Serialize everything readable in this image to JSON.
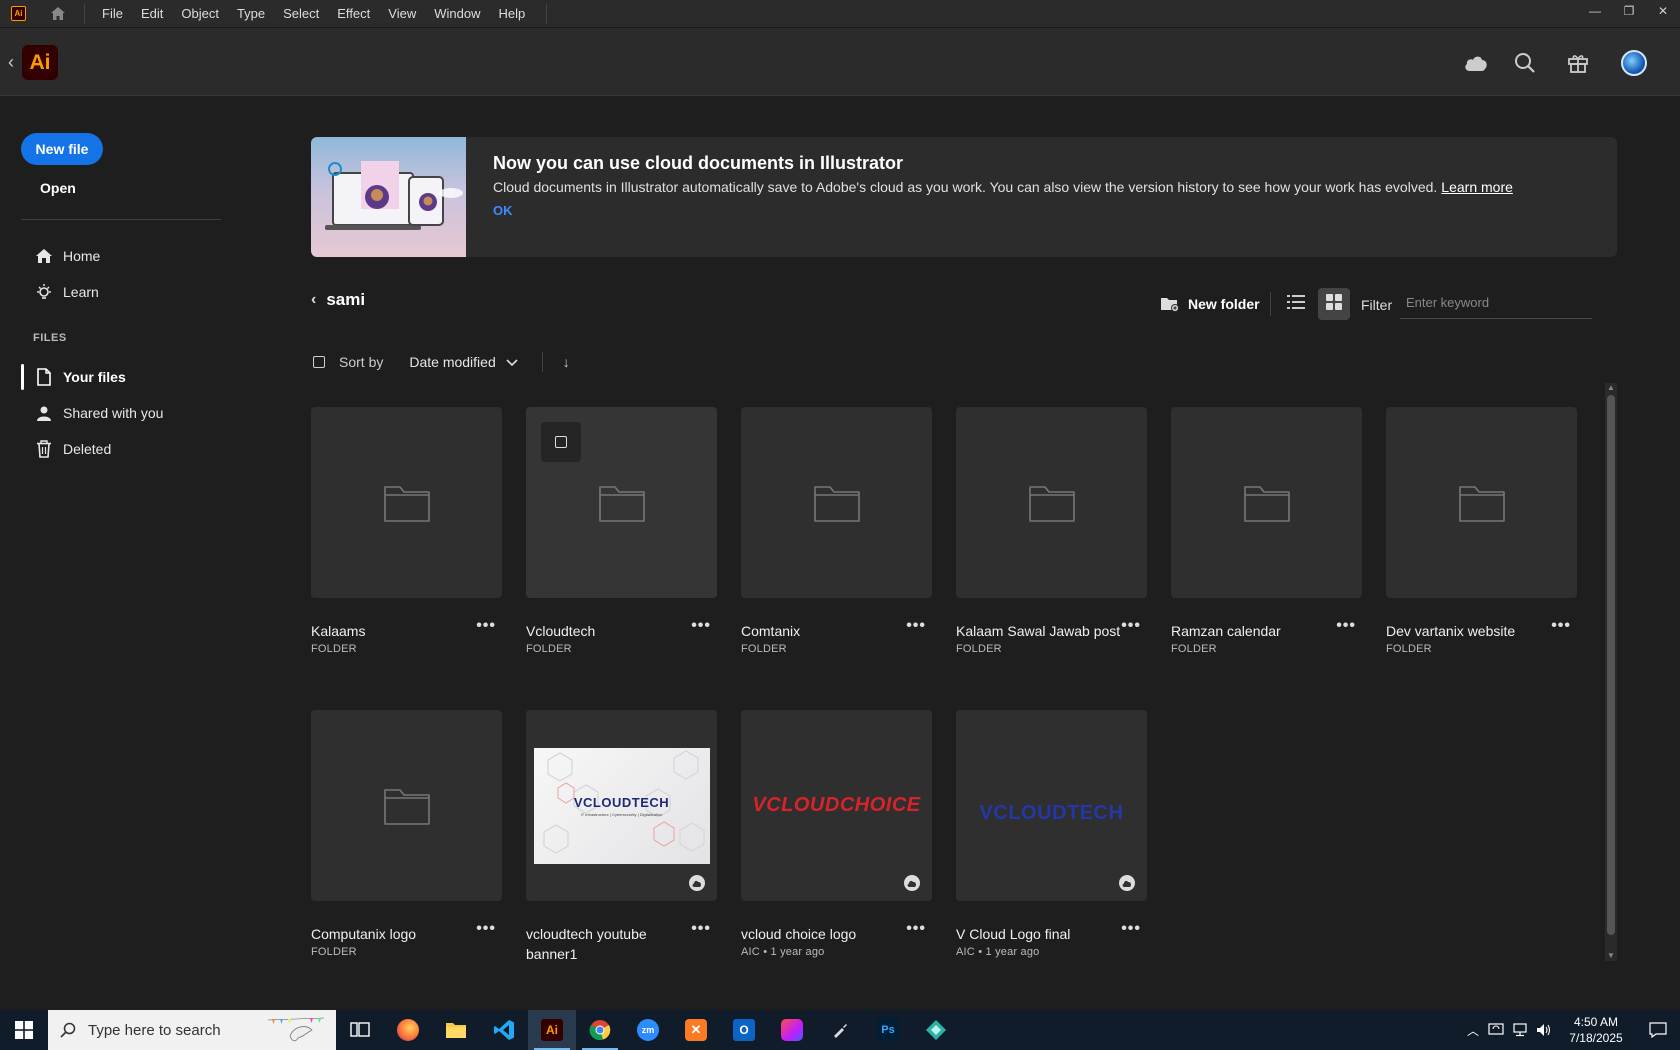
{
  "menubar": {
    "app_badge": "Ai",
    "items": [
      "File",
      "Edit",
      "Object",
      "Type",
      "Select",
      "Effect",
      "View",
      "Window",
      "Help"
    ],
    "window_controls": [
      "—",
      "❐",
      "✕"
    ]
  },
  "header": {
    "logo": "Ai",
    "icons": [
      "cloud-icon",
      "search-icon",
      "gift-icon",
      "avatar"
    ]
  },
  "sidebar": {
    "new_file": "New file",
    "open": "Open",
    "nav": [
      {
        "label": "Home",
        "icon": "home-icon"
      },
      {
        "label": "Learn",
        "icon": "lightbulb-icon"
      }
    ],
    "files_label": "FILES",
    "files": [
      {
        "label": "Your files",
        "icon": "file-icon",
        "active": true
      },
      {
        "label": "Shared with you",
        "icon": "shared-user-icon",
        "active": false
      },
      {
        "label": "Deleted",
        "icon": "trash-icon",
        "active": false
      }
    ]
  },
  "banner": {
    "title": "Now you can use cloud documents in Illustrator",
    "description": "Cloud documents in Illustrator automatically save to Adobe's cloud as you work. You can also view the version history to see how your work has evolved.",
    "learn_more": "Learn more",
    "ok": "OK"
  },
  "breadcrumb": {
    "folder": "sami"
  },
  "toolbar": {
    "new_folder": "New folder",
    "filter_label": "Filter",
    "filter_placeholder": "Enter keyword",
    "view_mode": "grid"
  },
  "sort": {
    "label": "Sort by",
    "value": "Date modified",
    "direction": "↓"
  },
  "items": [
    {
      "name": "Kalaams",
      "meta": "FOLDER",
      "type": "folder"
    },
    {
      "name": "Vcloudtech",
      "meta": "FOLDER",
      "type": "folder",
      "hovered": true
    },
    {
      "name": "Comtanix",
      "meta": "FOLDER",
      "type": "folder"
    },
    {
      "name": "Kalaam Sawal Jawab post",
      "meta": "FOLDER",
      "type": "folder"
    },
    {
      "name": "Ramzan calendar",
      "meta": "FOLDER",
      "type": "folder"
    },
    {
      "name": "Dev vartanix website",
      "meta": "FOLDER",
      "type": "folder"
    },
    {
      "name": "Computanix logo",
      "meta": "FOLDER",
      "type": "folder"
    },
    {
      "name": "vcloudtech youtube banner1",
      "meta": "",
      "type": "banner",
      "thumb_text": "VCLOUDTECH",
      "thumb_sub": "IT Infrastructure | Cybersecurity | Digitalization"
    },
    {
      "name": "vcloud choice logo",
      "meta": "AIC • 1 year ago",
      "type": "logo",
      "thumb_text": "VCLOUDCHOICE"
    },
    {
      "name": "V Cloud Logo final",
      "meta": "AIC • 1 year ago",
      "type": "logo2",
      "thumb_text": "VCLOUDTECH"
    }
  ],
  "more_glyph": "•••",
  "taskbar": {
    "search_placeholder": "Type here to search",
    "apps": [
      "task-view",
      "firefox",
      "file-explorer",
      "vscode",
      "illustrator",
      "chrome",
      "zoom",
      "xampp",
      "outlook",
      "creative-cloud",
      "pen-tool",
      "photoshop",
      "app"
    ],
    "time": "4:50 AM",
    "date": "7/18/2025"
  },
  "colors": {
    "accent": "#1473e6",
    "ai_orange": "#ff9a00",
    "ai_bg": "#330000",
    "bg": "#1e1e1e",
    "card": "#2f2f2f"
  }
}
